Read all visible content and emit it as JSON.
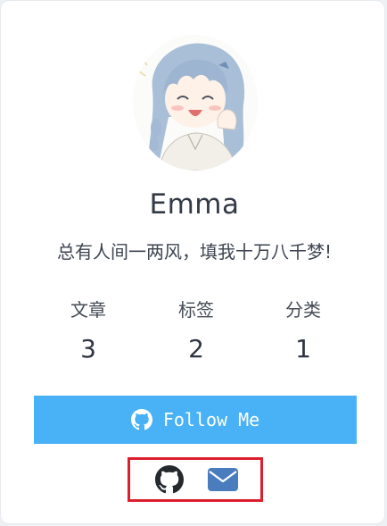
{
  "profile": {
    "name": "Emma",
    "bio": "总有人间一两风，填我十万八千梦!"
  },
  "stats": [
    {
      "label": "文章",
      "value": "3"
    },
    {
      "label": "标签",
      "value": "2"
    },
    {
      "label": "分类",
      "value": "1"
    }
  ],
  "follow": {
    "label": "Follow Me",
    "color": "#49b1f5",
    "icon": "github-icon"
  },
  "social_links": [
    {
      "icon": "github-icon",
      "color": "#24292e"
    },
    {
      "icon": "envelope-icon",
      "color": "#4a7dbe"
    }
  ],
  "highlight_color": "#dc1f2e"
}
